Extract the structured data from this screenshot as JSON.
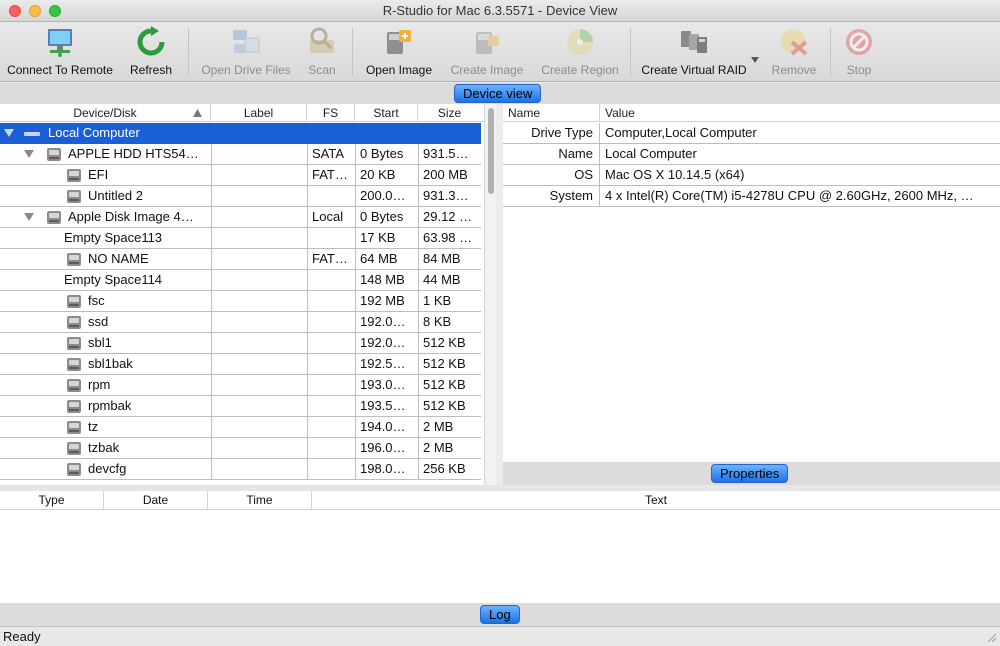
{
  "window": {
    "title": "R-Studio for Mac 6.3.5571 - Device View"
  },
  "toolbar": {
    "buttons": [
      {
        "label": "Connect To Remote",
        "icon": "monitor-network-icon",
        "enabled": true
      },
      {
        "label": "Refresh",
        "icon": "refresh-icon",
        "enabled": true
      },
      {
        "label": "Open Drive Files",
        "icon": "drive-files-icon",
        "enabled": false
      },
      {
        "label": "Scan",
        "icon": "scan-icon",
        "enabled": false
      },
      {
        "label": "Open Image",
        "icon": "open-image-icon",
        "enabled": true
      },
      {
        "label": "Create Image",
        "icon": "create-image-icon",
        "enabled": false
      },
      {
        "label": "Create Region",
        "icon": "create-region-icon",
        "enabled": false
      },
      {
        "label": "Create Virtual RAID",
        "icon": "virtual-raid-icon",
        "enabled": true
      },
      {
        "label": "Remove",
        "icon": "remove-icon",
        "enabled": false
      },
      {
        "label": "Stop",
        "icon": "stop-icon",
        "enabled": false
      }
    ]
  },
  "device_view": {
    "header_button": "Device view",
    "columns": [
      "Device/Disk",
      "Label",
      "FS",
      "Start",
      "Size"
    ],
    "rows": [
      {
        "level": 0,
        "expanded": true,
        "icon": "computer-icon",
        "name": "Local Computer",
        "label": "",
        "fs": "",
        "start": "",
        "size": "",
        "selected": true
      },
      {
        "level": 1,
        "expanded": true,
        "icon": "hdd-icon",
        "name": "APPLE HDD HTS54…",
        "label": "",
        "fs": "SATA",
        "start": "0 Bytes",
        "size": "931.5…"
      },
      {
        "level": 2,
        "icon": "hdd-icon",
        "name": "EFI",
        "label": "",
        "fs": "FAT…",
        "start": "20 KB",
        "size": "200 MB"
      },
      {
        "level": 2,
        "icon": "hdd-icon",
        "name": "Untitled 2",
        "label": "",
        "fs": "",
        "start": "200.0…",
        "size": "931.3…"
      },
      {
        "level": 1,
        "expanded": true,
        "icon": "hdd-icon",
        "name": "Apple Disk Image 4…",
        "label": "",
        "fs": "Local",
        "start": "0 Bytes",
        "size": "29.12 …"
      },
      {
        "level": 2,
        "icon": "",
        "name": "Empty Space113",
        "label": "",
        "fs": "",
        "start": "17 KB",
        "size": "63.98 …"
      },
      {
        "level": 2,
        "icon": "hdd-icon",
        "name": "NO NAME",
        "label": "",
        "fs": "FAT…",
        "start": "64 MB",
        "size": "84 MB"
      },
      {
        "level": 2,
        "icon": "",
        "name": "Empty Space114",
        "label": "",
        "fs": "",
        "start": "148 MB",
        "size": "44 MB"
      },
      {
        "level": 2,
        "icon": "hdd-icon",
        "name": "fsc",
        "label": "",
        "fs": "",
        "start": "192 MB",
        "size": "1 KB"
      },
      {
        "level": 2,
        "icon": "hdd-icon",
        "name": "ssd",
        "label": "",
        "fs": "",
        "start": "192.0…",
        "size": "8 KB"
      },
      {
        "level": 2,
        "icon": "hdd-icon",
        "name": "sbl1",
        "label": "",
        "fs": "",
        "start": "192.0…",
        "size": "512 KB"
      },
      {
        "level": 2,
        "icon": "hdd-icon",
        "name": "sbl1bak",
        "label": "",
        "fs": "",
        "start": "192.5…",
        "size": "512 KB"
      },
      {
        "level": 2,
        "icon": "hdd-icon",
        "name": "rpm",
        "label": "",
        "fs": "",
        "start": "193.0…",
        "size": "512 KB"
      },
      {
        "level": 2,
        "icon": "hdd-icon",
        "name": "rpmbak",
        "label": "",
        "fs": "",
        "start": "193.5…",
        "size": "512 KB"
      },
      {
        "level": 2,
        "icon": "hdd-icon",
        "name": "tz",
        "label": "",
        "fs": "",
        "start": "194.0…",
        "size": "2 MB"
      },
      {
        "level": 2,
        "icon": "hdd-icon",
        "name": "tzbak",
        "label": "",
        "fs": "",
        "start": "196.0…",
        "size": "2 MB"
      },
      {
        "level": 2,
        "icon": "hdd-icon",
        "name": "devcfg",
        "label": "",
        "fs": "",
        "start": "198.0…",
        "size": "256 KB"
      }
    ]
  },
  "properties": {
    "header_button": "Properties",
    "columns": [
      "Name",
      "Value"
    ],
    "rows": [
      {
        "name": "Drive Type",
        "value": "Computer,Local Computer"
      },
      {
        "name": "Name",
        "value": "Local Computer"
      },
      {
        "name": "OS",
        "value": "Mac OS X 10.14.5 (x64)"
      },
      {
        "name": "System",
        "value": "4 x Intel(R) Core(TM) i5-4278U CPU @ 2.60GHz, 2600 MHz, …"
      }
    ]
  },
  "log": {
    "header_button": "Log",
    "columns": [
      "Type",
      "Date",
      "Time",
      "Text"
    ]
  },
  "status": {
    "text": "Ready"
  },
  "colors": {
    "selection": "#1b5fd6",
    "accent_button": "#1a73e8"
  }
}
